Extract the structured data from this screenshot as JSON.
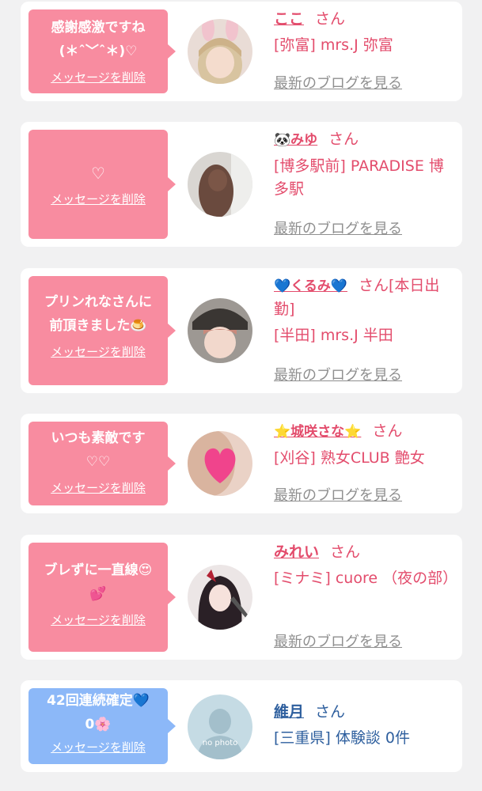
{
  "cards": [
    {
      "message": "感謝感激ですね\n(＊ˆ﹀ˆ＊)♡",
      "delete_label": "メッセージを削除",
      "name": "ここ",
      "suffix": "さん",
      "shop": "[弥富] mrs.J 弥富",
      "blog_link": "最新のブログを見る",
      "avatar": "bunny-ears-portrait"
    },
    {
      "message": "♡",
      "delete_label": "メッセージを削除",
      "name": "🐼みゆ",
      "suffix": "さん",
      "shop": "[博多駅前] PARADISE 博多駅",
      "blog_link": "最新のブログを見る",
      "avatar": "long-hair-portrait"
    },
    {
      "message": "プリンれなさんに前頂きました🍮",
      "delete_label": "メッセージを削除",
      "name": "💙くるみ💙",
      "suffix": "さん[本日出勤]",
      "shop": "[半田] mrs.J 半田",
      "blog_link": "最新のブログを見る",
      "avatar": "cap-portrait"
    },
    {
      "message": "いつも素敵です\n♡♡",
      "delete_label": "メッセージを削除",
      "name": "⭐城咲さな⭐",
      "suffix": "さん",
      "shop": "[刈谷] 熟女CLUB 艶女",
      "blog_link": "最新のブログを見る",
      "avatar": "heart-sticker-portrait"
    },
    {
      "message": "ブレずに一直線😍\n💕",
      "delete_label": "メッセージを削除",
      "name": "みれい",
      "suffix": "さん",
      "shop": "[ミナミ] cuore （夜の部）",
      "blog_link": "最新のブログを見る",
      "avatar": "anime-character-portrait"
    },
    {
      "message": "42回連続確定💙\n0🌸",
      "delete_label": "メッセージを削除",
      "name": "維月",
      "suffix": "さん",
      "shop": "[三重県] 体験談 0件",
      "avatar": "no-photo-placeholder",
      "avatar_text": "no photo"
    }
  ],
  "colors": {
    "pink_bubble": "#f88ca0",
    "blue_bubble": "#8cb8f8",
    "pink_text": "#e34c6c",
    "blue_text": "#2e5f9e",
    "link_gray": "#8f8f8f"
  }
}
